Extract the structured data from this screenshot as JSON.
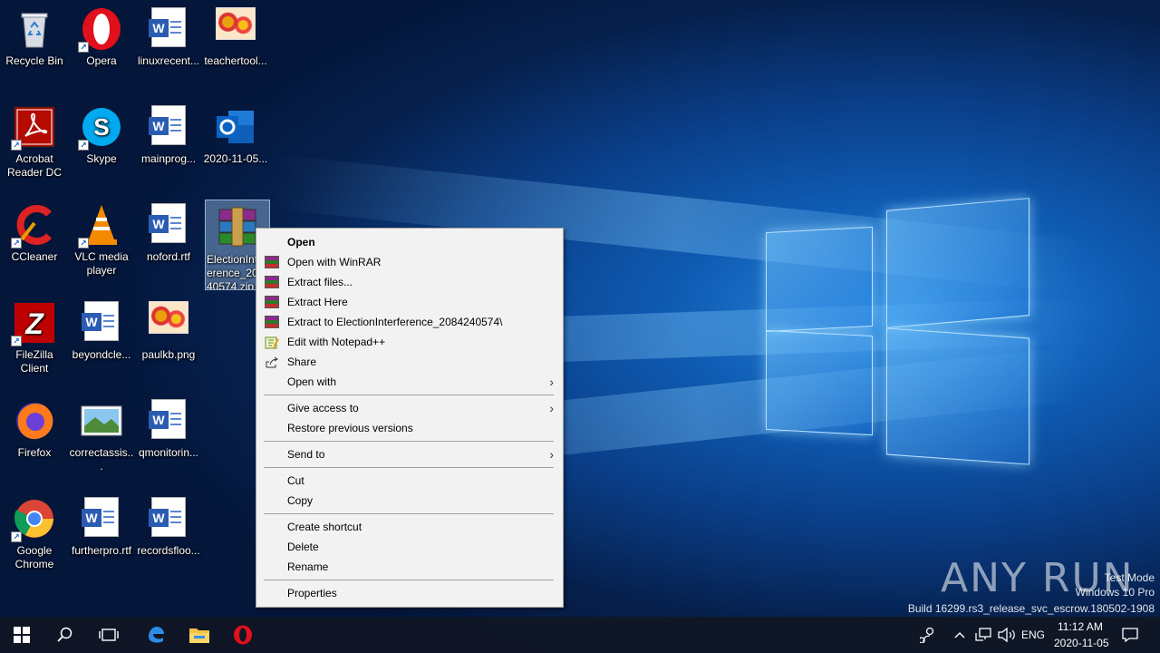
{
  "desktop": {
    "icons": [
      {
        "label": "Recycle Bin",
        "icon": "recycle-bin-icon"
      },
      {
        "label": "Opera",
        "icon": "opera-icon"
      },
      {
        "label": "linuxrecent...",
        "icon": "word-document-icon"
      },
      {
        "label": "teachertool...",
        "icon": "image-file-icon"
      },
      {
        "label": "Acrobat Reader DC",
        "icon": "acrobat-icon"
      },
      {
        "label": "Skype",
        "icon": "skype-icon"
      },
      {
        "label": "mainprog...",
        "icon": "word-document-icon"
      },
      {
        "label": "2020-11-05...",
        "icon": "outlook-icon"
      },
      {
        "label": "CCleaner",
        "icon": "ccleaner-icon"
      },
      {
        "label": "VLC media player",
        "icon": "vlc-icon"
      },
      {
        "label": "noford.rtf",
        "icon": "word-document-icon"
      },
      {
        "label": "ElectionInterference_2084240574.zip",
        "icon": "winrar-archive-icon"
      },
      {
        "label": "FileZilla Client",
        "icon": "filezilla-icon"
      },
      {
        "label": "beyondcle...",
        "icon": "word-document-icon"
      },
      {
        "label": "paulkb.png",
        "icon": "image-file-icon"
      },
      {
        "label": "Firefox",
        "icon": "firefox-icon"
      },
      {
        "label": "correctassis...",
        "icon": "landscape-image-icon"
      },
      {
        "label": "qmonitorin...",
        "icon": "word-document-icon"
      },
      {
        "label": "Google Chrome",
        "icon": "chrome-icon"
      },
      {
        "label": "furtherpro.rtf",
        "icon": "word-document-icon"
      },
      {
        "label": "recordsfloo...",
        "icon": "word-document-icon"
      }
    ],
    "selected_label_visible": "ElectionInt erence_20( 40574.zip"
  },
  "context_menu": {
    "items": [
      {
        "label": "Open",
        "bold": true
      },
      {
        "label": "Open with WinRAR",
        "icon": "winrar-icon"
      },
      {
        "label": "Extract files...",
        "icon": "winrar-icon"
      },
      {
        "label": "Extract Here",
        "icon": "winrar-icon"
      },
      {
        "label": "Extract to ElectionInterference_2084240574\\",
        "icon": "winrar-icon"
      },
      {
        "label": "Edit with Notepad++",
        "icon": "notepadpp-icon"
      },
      {
        "label": "Share",
        "icon": "share-icon"
      },
      {
        "label": "Open with",
        "submenu": true
      },
      {
        "label": "Give access to",
        "submenu": true
      },
      {
        "label": "Restore previous versions"
      },
      {
        "label": "Send to",
        "submenu": true
      },
      {
        "label": "Cut"
      },
      {
        "label": "Copy"
      },
      {
        "label": "Create shortcut"
      },
      {
        "label": "Delete"
      },
      {
        "label": "Rename"
      },
      {
        "label": "Properties"
      }
    ]
  },
  "watermark": {
    "brand": "ANY RUN",
    "line1": "Test Mode",
    "line2": "Windows 10 Pro",
    "line3": "Build 16299.rs3_release_svc_escrow.180502-1908"
  },
  "taskbar": {
    "buttons": [
      "start-icon",
      "search-icon",
      "task-view-icon",
      "edge-icon",
      "file-explorer-icon",
      "opera-icon"
    ],
    "language": "ENG",
    "time": "11:12 AM",
    "date": "2020-11-05"
  }
}
